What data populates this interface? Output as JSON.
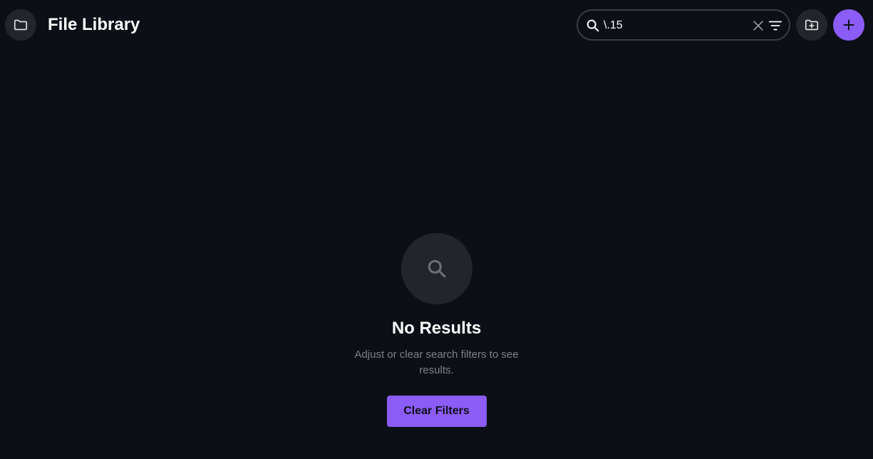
{
  "header": {
    "title": "File Library",
    "folder_icon": "folder-icon",
    "new_folder_icon": "folder-plus-icon",
    "add_icon": "plus-icon"
  },
  "search": {
    "value": "\\.15",
    "placeholder": "",
    "icons": [
      "search-icon",
      "clear-icon",
      "filter-icon"
    ]
  },
  "empty_state": {
    "icon": "search-icon",
    "title": "No Results",
    "description": "Adjust or clear search filters to see results.",
    "button_label": "Clear Filters"
  },
  "colors": {
    "background": "#0d0f16",
    "surface": "#23252c",
    "accent": "#8b5cf6",
    "muted_text": "#7d808a"
  }
}
